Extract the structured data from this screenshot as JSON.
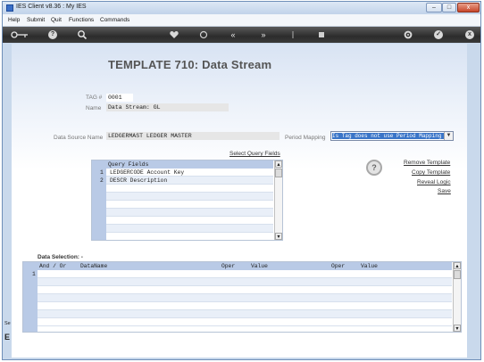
{
  "window": {
    "title": "IES Client v8.36 : My IES",
    "minimize": "–",
    "maximize": "□",
    "close": "x"
  },
  "menu": [
    "Help",
    "Submit",
    "Quit",
    "Functions",
    "Commands"
  ],
  "toolbar": {
    "icons": [
      "key-icon",
      "help-icon",
      "search-icon",
      "heart-icon",
      "refresh-icon",
      "rewind-icon",
      "forward-icon",
      "upload-icon",
      "stop-icon",
      "settings-icon",
      "check-icon",
      "close-icon"
    ],
    "glyphs": {
      "help": "?",
      "close": "x",
      "check": "✓",
      "rewind": "«",
      "forward": "»"
    }
  },
  "page": {
    "title": "TEMPLATE 710: Data Stream"
  },
  "form": {
    "tag_label": "TAG #",
    "tag_value": "0001",
    "name_label": "Name",
    "name_value": "Data Stream: GL",
    "ds_label": "Data Source Name",
    "ds_value": "LEDGERMAST LEDGER MASTER",
    "pm_label": "Period Mapping",
    "pm_value": "Is Tag does not use Period Mapping"
  },
  "query": {
    "select_link": "Select Query Fields",
    "header": "Query Fields",
    "rows": [
      {
        "num": "1",
        "field": "LEDGERCODE Account Key"
      },
      {
        "num": "2",
        "field": "DESCR Description"
      }
    ]
  },
  "actions": {
    "help_glyph": "?",
    "remove": "Remove Template",
    "copy": "Copy Template",
    "reval": "Reveal Logic",
    "save": "Save"
  },
  "selection": {
    "label": "Data Selection: -",
    "headers": {
      "andor": "And / Or",
      "dataname": "DataName",
      "oper1": "Oper",
      "value1": "Value",
      "oper2": "Oper",
      "value2": "Value"
    },
    "rows": [
      {
        "num": "1"
      }
    ]
  },
  "left_strip": {
    "se": "Se",
    "e": "E"
  },
  "colors": {
    "header_blue": "#b9cae6",
    "selected_blue": "#3a75c8",
    "titlebar": "#c9d9ec"
  }
}
